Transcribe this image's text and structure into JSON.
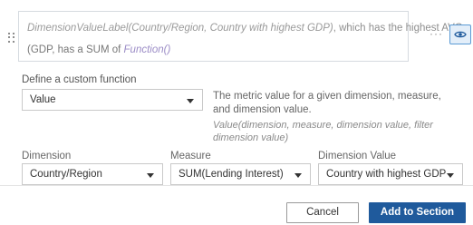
{
  "editor": {
    "line1_fn": "DimensionValueLabel(Country/Region, Country with highest GDP)",
    "line1_rest": ", which has the highest AVG",
    "line2_prefix": "(GDP, has a SUM of ",
    "line2_fn": "Function()",
    "line2_suffix": ""
  },
  "toolbar": {
    "more_icon": "more-icon",
    "eye_icon": "eye-icon",
    "more_glyph": "···"
  },
  "custom_function": {
    "label": "Define a custom function",
    "selected": "Value",
    "description": "The metric value for a given dimension, measure, and dimension value.",
    "signature": "Value(dimension, measure, dimension value, filter dimension value)"
  },
  "fields": {
    "dimension": {
      "label": "Dimension",
      "value": "Country/Region"
    },
    "measure": {
      "label": "Measure",
      "value": "SUM(Lending Interest)"
    },
    "dimension_value": {
      "label": "Dimension Value",
      "value": "Country with highest GDP"
    }
  },
  "buttons": {
    "cancel": "Cancel",
    "add": "Add to Section"
  },
  "colors": {
    "primary": "#1f5a9c",
    "fn_purple": "#9b8cc6",
    "eye_bg": "#e3eef9",
    "eye_border": "#5b9bd5"
  }
}
